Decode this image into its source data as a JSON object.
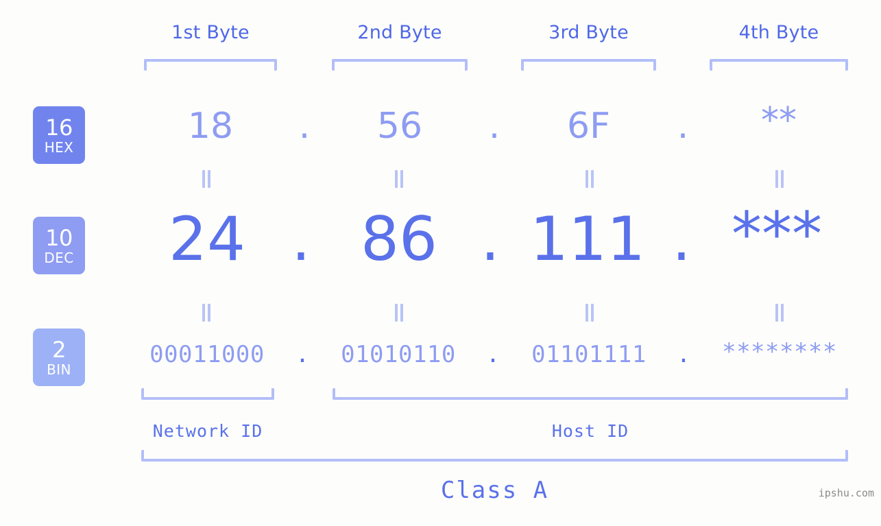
{
  "meta": {
    "background_color": "#fdfefb",
    "accent_color": "#5a71ea",
    "accent_light_color": "#8e9cf2",
    "bracket_color": "#b3bef8",
    "watermark": "ipshu.com"
  },
  "header": {
    "bytes": [
      {
        "label": "1st Byte"
      },
      {
        "label": "2nd Byte"
      },
      {
        "label": "3rd Byte"
      },
      {
        "label": "4th Byte"
      }
    ]
  },
  "bases": [
    {
      "number": "16",
      "system": "HEX",
      "color": "#7184ee"
    },
    {
      "number": "10",
      "system": "DEC",
      "color": "#8e9cf2"
    },
    {
      "number": "2",
      "system": "BIN",
      "color": "#9db1f6"
    }
  ],
  "rows": {
    "hex": {
      "base": "16",
      "system": "HEX",
      "values": [
        "18",
        "56",
        "6F",
        "**"
      ],
      "separator": "."
    },
    "dec": {
      "base": "10",
      "system": "DEC",
      "values": [
        "24",
        "86",
        "111",
        "***"
      ],
      "separator": "."
    },
    "bin": {
      "base": "2",
      "system": "BIN",
      "values": [
        "00011000",
        "01010110",
        "01101111",
        "********"
      ],
      "separator": "."
    }
  },
  "equals_mark": "=",
  "sections": {
    "network_id": "Network ID",
    "host_id": "Host ID",
    "class": "Class A"
  }
}
